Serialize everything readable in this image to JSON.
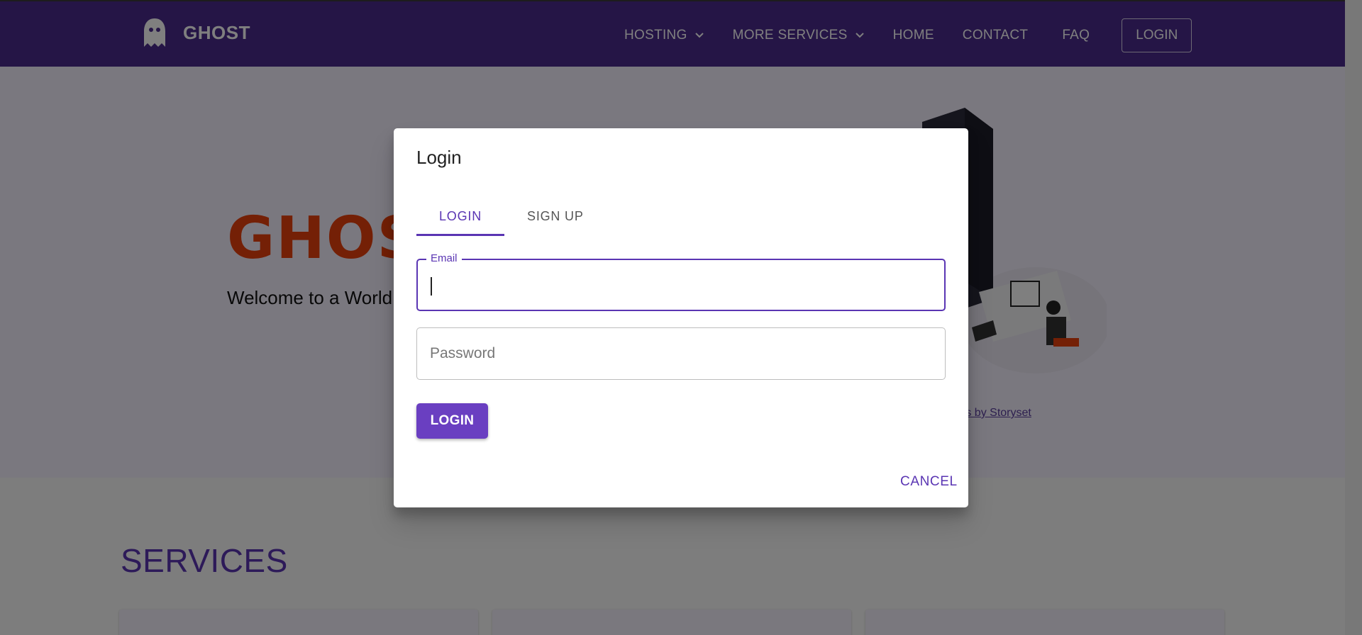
{
  "header": {
    "brand": "GHOST",
    "nav": [
      {
        "label": "HOSTING",
        "has_dropdown": true
      },
      {
        "label": "MORE SERVICES",
        "has_dropdown": true
      },
      {
        "label": "HOME",
        "has_dropdown": false
      },
      {
        "label": "CONTACT",
        "has_dropdown": false
      },
      {
        "label": "FAQ",
        "has_dropdown": false
      }
    ],
    "login_label": "LOGIN"
  },
  "hero": {
    "title": "GHOS",
    "subtitle": "Welcome to a World Meets Excellence, a",
    "credit": "ions by Storyset"
  },
  "services": {
    "title": "SERVICES"
  },
  "dialog": {
    "title": "Login",
    "tabs": [
      {
        "label": "LOGIN",
        "active": true
      },
      {
        "label": "SIGN UP",
        "active": false
      }
    ],
    "email": {
      "label": "Email",
      "value": ""
    },
    "password": {
      "placeholder": "Password",
      "value": ""
    },
    "submit_label": "LOGIN",
    "cancel_label": "CANCEL"
  },
  "colors": {
    "primary": "#5a35b3",
    "header_bg": "#4a2b8c",
    "hero_title": "#e8400c"
  },
  "icons": [
    "ghost-logo-icon",
    "chevron-down-icon"
  ]
}
